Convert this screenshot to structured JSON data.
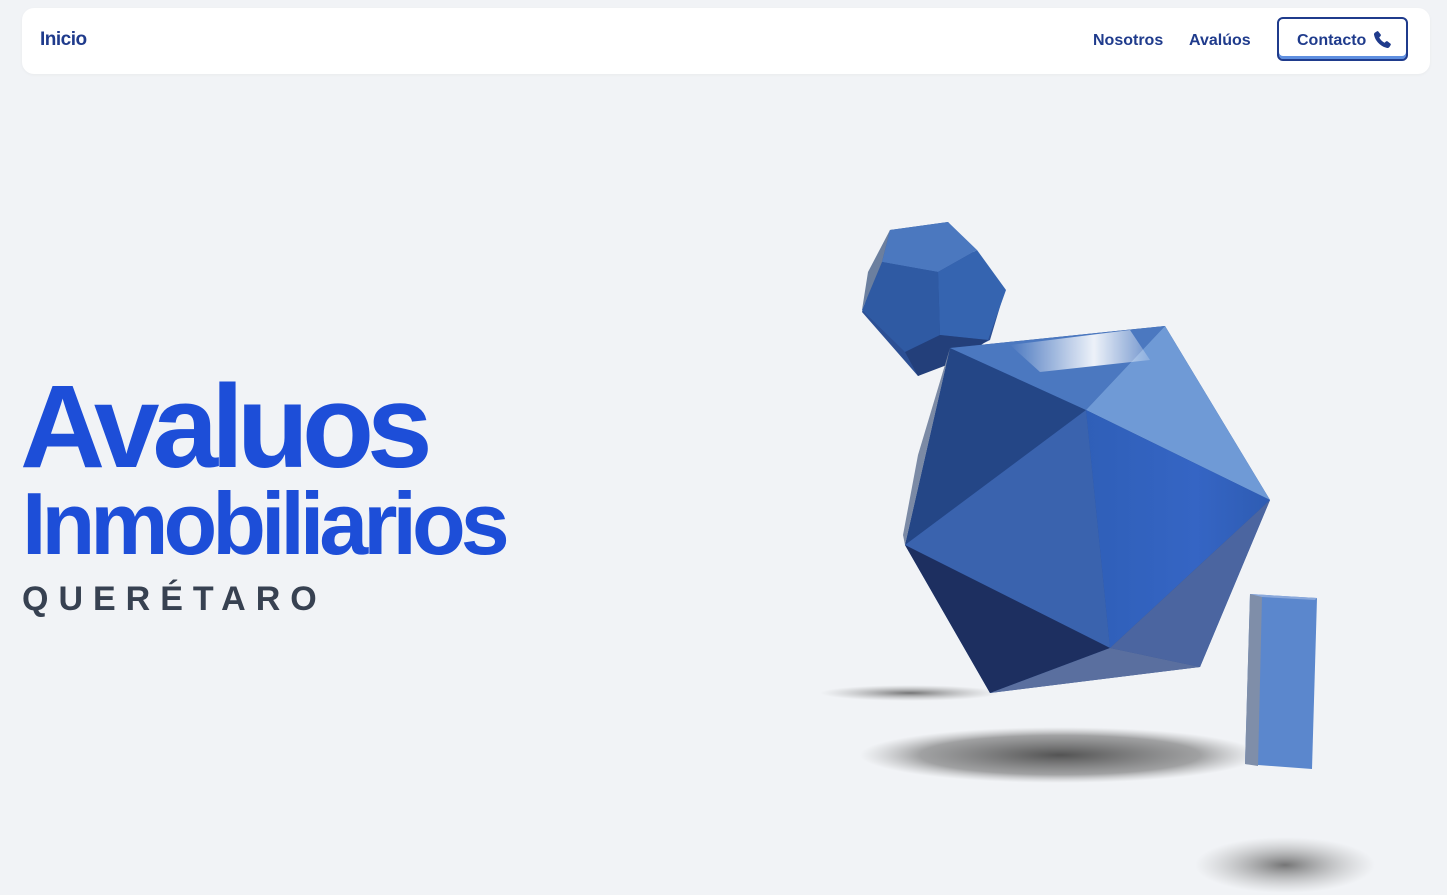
{
  "nav": {
    "home_label": "Inicio",
    "links": [
      {
        "label": "Nosotros"
      },
      {
        "label": "Avalúos"
      }
    ],
    "contact_label": "Contacto",
    "contact_icon": "phone-icon"
  },
  "hero": {
    "title_line1": "Avaluos",
    "title_line2": "Inmobiliarios",
    "subtitle": "QUERÉTARO"
  },
  "colors": {
    "brand_blue": "#1d4ed8",
    "nav_text": "#1f3b8c",
    "subtitle_text": "#374151",
    "background": "#f1f3f6"
  }
}
